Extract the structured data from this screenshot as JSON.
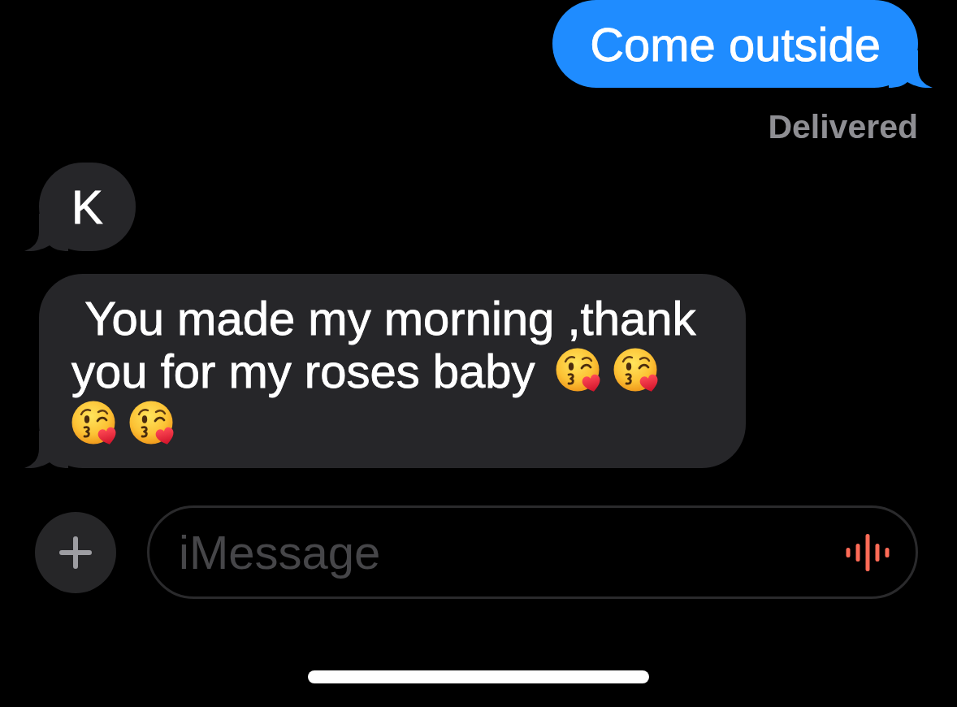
{
  "messages": [
    {
      "kind": "outgoing",
      "text": "Come outside",
      "status": "Delivered"
    },
    {
      "kind": "incoming",
      "text": "K"
    },
    {
      "kind": "incoming",
      "text": " You made my morning ,thank you for my roses baby",
      "emojis": [
        {
          "kind": "blowing-kiss"
        },
        {
          "kind": "blowing-kiss"
        },
        {
          "kind": "blowing-kiss"
        },
        {
          "kind": "blowing-kiss"
        }
      ]
    }
  ],
  "composer": {
    "placeholder": "iMessage"
  }
}
